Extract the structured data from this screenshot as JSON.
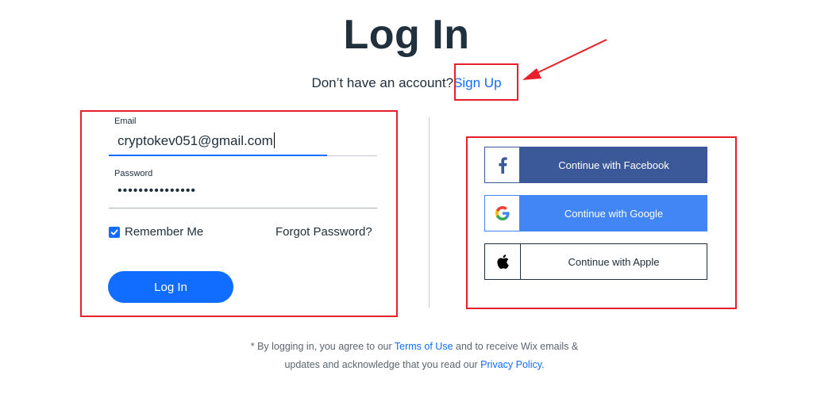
{
  "header": {
    "title": "Log In",
    "no_account_text": "Don’t have an account?",
    "signup_link": "Sign Up"
  },
  "form": {
    "email_label": "Email",
    "email_value": "cryptokev051@gmail.com",
    "password_label": "Password",
    "password_value": "•••••••••••••••",
    "remember_label": "Remember Me",
    "remember_checked": true,
    "forgot_label": "Forgot Password?",
    "login_button": "Log In"
  },
  "social": {
    "facebook": "Continue with Facebook",
    "google": "Continue with Google",
    "apple": "Continue with Apple"
  },
  "footer": {
    "part1": "* By logging in, you agree to our ",
    "terms_link": "Terms of Use",
    "part2": " and to receive Wix emails & updates and acknowledge that you read our ",
    "privacy_link": "Privacy Policy",
    "part3": "."
  },
  "colors": {
    "accent": "#116dff",
    "facebook": "#3b5998",
    "google": "#4285f4",
    "annotation": "#e8202a"
  }
}
